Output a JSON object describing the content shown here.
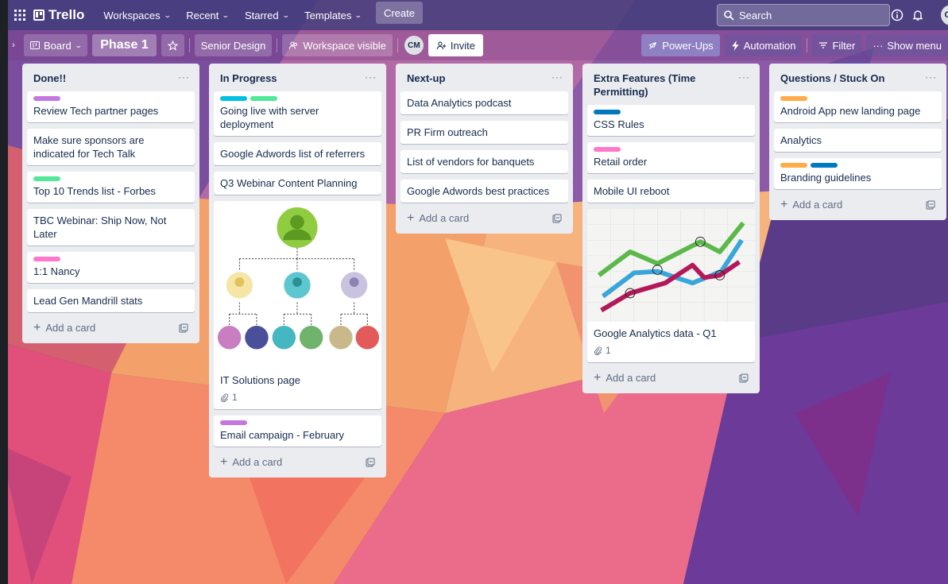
{
  "nav": {
    "logo": "Trello",
    "menus": [
      "Workspaces",
      "Recent",
      "Starred",
      "Templates"
    ],
    "create": "Create",
    "search_placeholder": "Search",
    "user_initials": "CM"
  },
  "board": {
    "view": "Board",
    "title": "Phase 1",
    "workspace": "Senior Design",
    "visibility": "Workspace visible",
    "member_initials": "CM",
    "invite": "Invite",
    "power_ups": "Power-Ups",
    "automation": "Automation",
    "filter": "Filter",
    "show_menu": "Show menu"
  },
  "label_colors": {
    "purple": "#c377e0",
    "green": "#51e898",
    "sky": "#00c2e0",
    "pink": "#ff78cb",
    "blue": "#0079bf",
    "orange": "#ffab4a"
  },
  "lists": [
    {
      "title": "Done!!",
      "cards": [
        {
          "title": "Review Tech partner pages",
          "labels": [
            "purple"
          ]
        },
        {
          "title": "Make sure sponsors are indicated for Tech Talk",
          "labels": []
        },
        {
          "title": "Top 10 Trends list - Forbes",
          "labels": [
            "green"
          ]
        },
        {
          "title": "TBC Webinar: Ship Now, Not Later",
          "labels": []
        },
        {
          "title": "1:1 Nancy",
          "labels": [
            "pink"
          ]
        },
        {
          "title": "Lead Gen Mandrill stats",
          "labels": []
        }
      ],
      "add_card": "Add a card"
    },
    {
      "title": "In Progress",
      "cards": [
        {
          "title": "Going live with server deployment",
          "labels": [
            "sky",
            "green"
          ]
        },
        {
          "title": "Google Adwords list of referrers",
          "labels": []
        },
        {
          "title": "Q3 Webinar Content Planning",
          "labels": []
        },
        {
          "title": "IT Solutions page",
          "labels": [],
          "cover": "org-chart",
          "attachments": "1"
        },
        {
          "title": "Email campaign - February",
          "labels": [
            "purple"
          ]
        }
      ],
      "add_card": "Add a card"
    },
    {
      "title": "Next-up",
      "cards": [
        {
          "title": "Data Analytics podcast",
          "labels": []
        },
        {
          "title": "PR Firm outreach",
          "labels": []
        },
        {
          "title": "List of vendors for banquets",
          "labels": []
        },
        {
          "title": "Google Adwords best practices",
          "labels": []
        }
      ],
      "add_card": "Add a card"
    },
    {
      "title": "Extra Features (Time Permitting)",
      "cards": [
        {
          "title": "CSS Rules",
          "labels": [
            "blue"
          ]
        },
        {
          "title": "Retail order",
          "labels": [
            "pink"
          ]
        },
        {
          "title": "Mobile UI reboot",
          "labels": []
        },
        {
          "title": "Google Analytics data - Q1",
          "labels": [],
          "cover": "line-graph",
          "attachments": "1"
        }
      ],
      "add_card": "Add a card"
    },
    {
      "title": "Questions / Stuck On",
      "cards": [
        {
          "title": "Android App new landing page",
          "labels": [
            "orange"
          ]
        },
        {
          "title": "Analytics",
          "labels": []
        },
        {
          "title": "Branding guidelines",
          "labels": [
            "orange",
            "blue"
          ]
        }
      ],
      "add_card": "Add a card"
    }
  ]
}
